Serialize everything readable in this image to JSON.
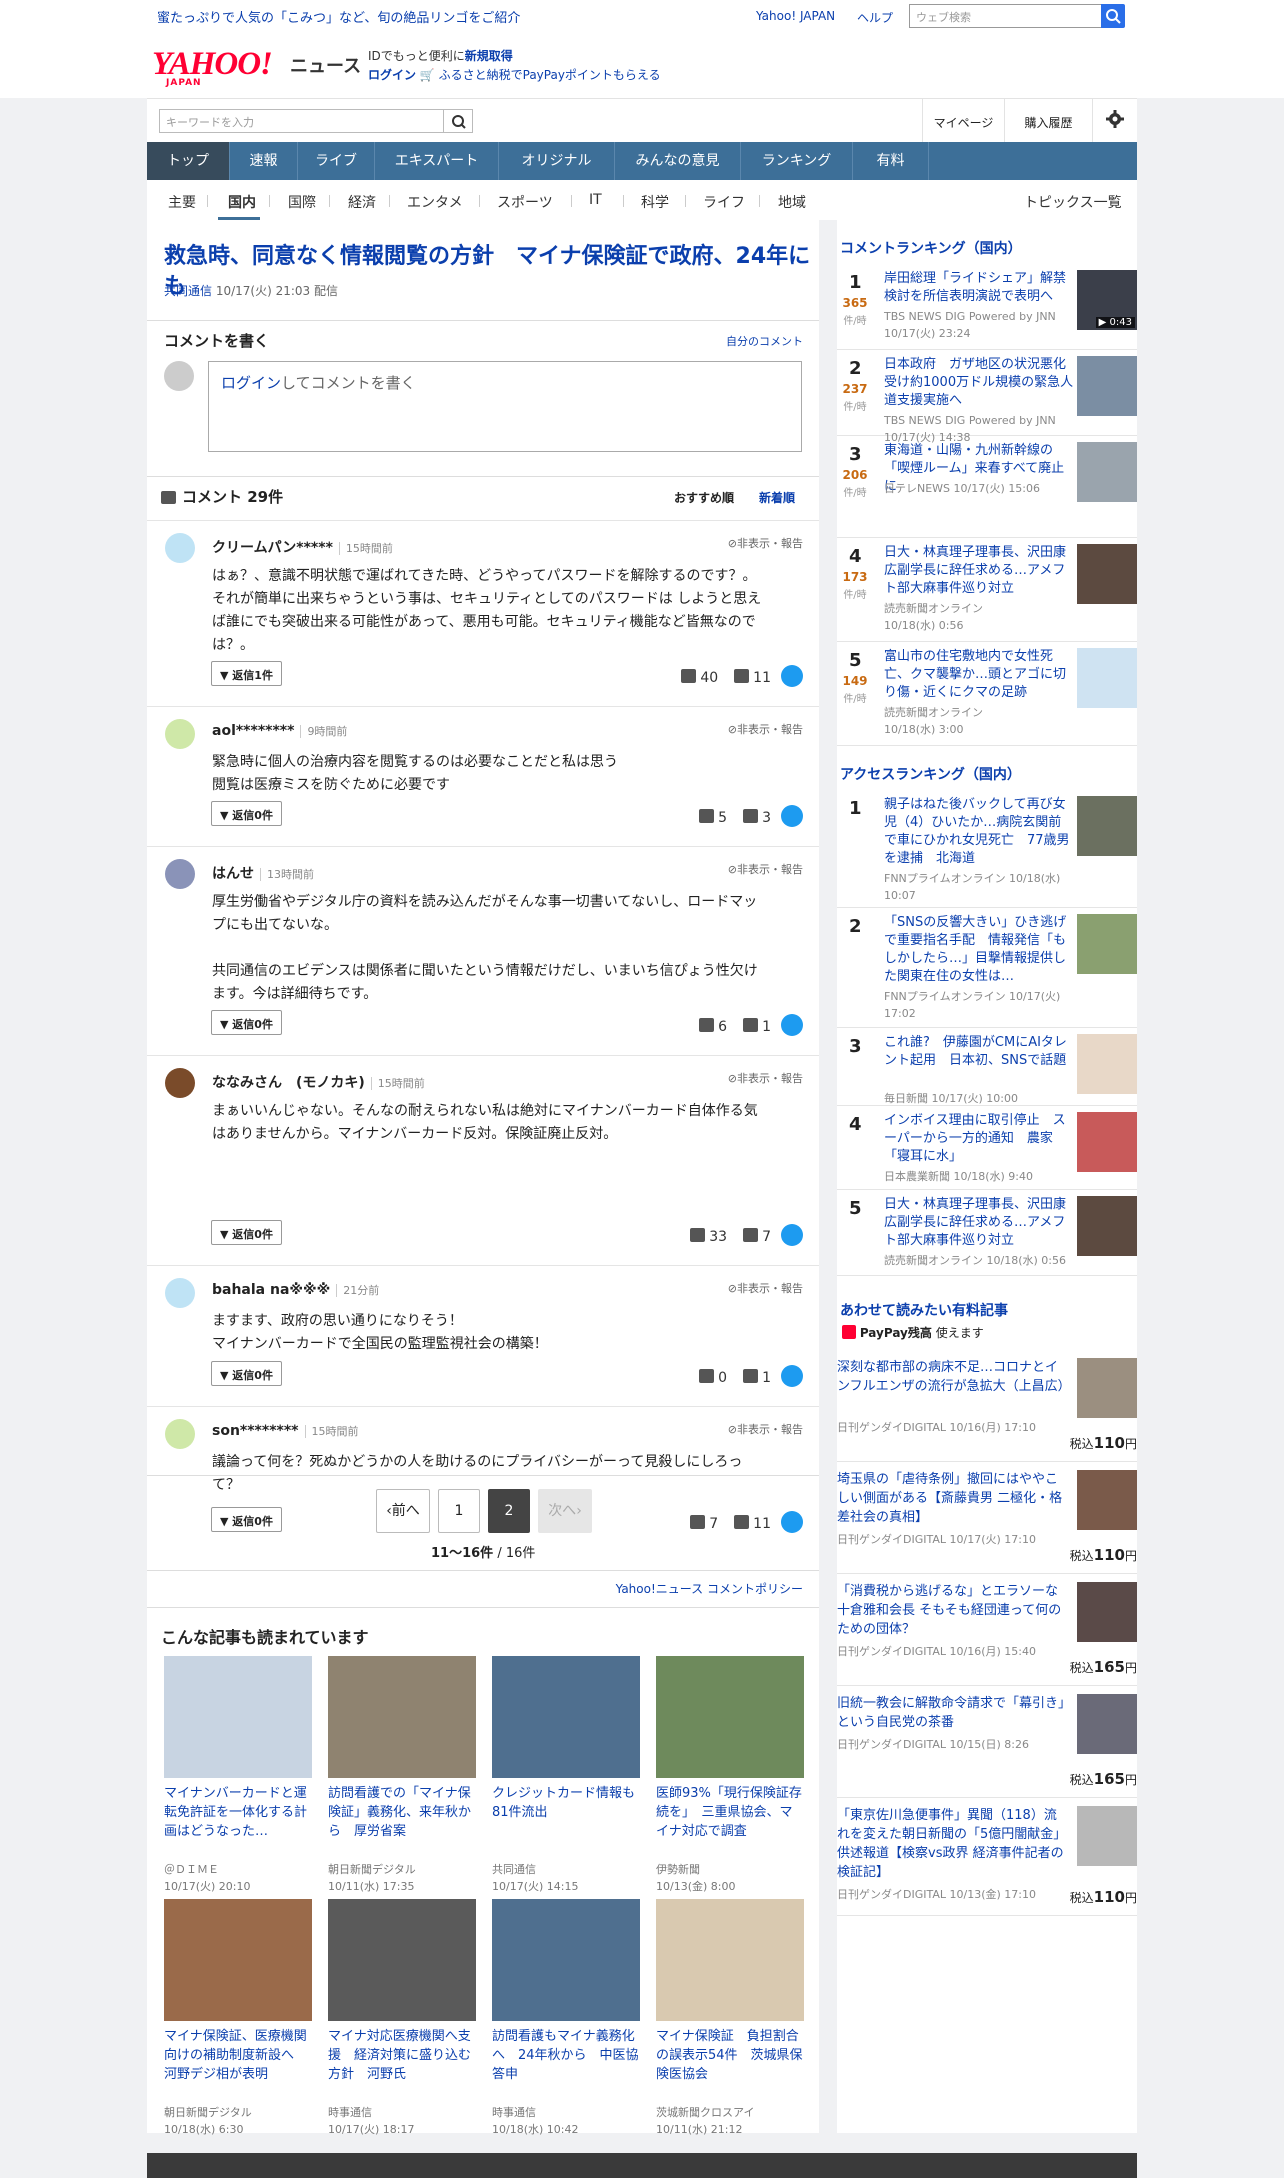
{
  "topbar": {
    "promo": "蜜たっぷりで人気の「こみつ」など、旬の絶品リンゴをご紹介",
    "yahoo_japan": "Yahoo! JAPAN",
    "help": "ヘルプ",
    "search_placeholder": "ウェブ検索"
  },
  "header": {
    "logo": "YAHOO!",
    "logo_sub": "JAPAN",
    "logo_news": "ニュース",
    "line1_prefix": "IDでもっと便利に",
    "line1_link": "新規取得",
    "login": "ログイン",
    "line2": "ふるさと納税でPayPayポイントもらえる"
  },
  "searchrow": {
    "placeholder": "キーワードを入力",
    "mypage": "マイページ",
    "history": "購入履歴"
  },
  "nav1": [
    "トップ",
    "速報",
    "ライブ",
    "エキスパート",
    "オリジナル",
    "みんなの意見",
    "ランキング",
    "有料"
  ],
  "nav2": [
    "主要",
    "国内",
    "国際",
    "経済",
    "エンタメ",
    "スポーツ",
    "IT",
    "科学",
    "ライフ",
    "地域"
  ],
  "nav2_all": "トピックス一覧",
  "article": {
    "title": "救急時、同意なく情報閲覧の方針　マイナ保険証で政府、24年にも",
    "source": "共同通信",
    "date": "10/17(火) 21:03 配信"
  },
  "comment_write": {
    "title": "コメントを書く",
    "own": "自分のコメント",
    "login": "ログイン",
    "placeholder": "してコメントを書く"
  },
  "comments_head": {
    "title": "コメント 29件",
    "sort_recommended": "おすすめ順",
    "sort_new": "新着順"
  },
  "comment_hide": "非表示・報告",
  "comments": [
    {
      "user": "クリームパン*****",
      "time": "15時間前",
      "body": "はぁ？、意識不明状態で運ばれてきた時、どうやってパスワードを解除するのです？。\nそれが簡単に出来ちゃうという事は、セキュリティとしてのパスワードは しようと思え\nば誰にでも突破出来る可能性があって、悪用も可能。セキュリティ機能など皆無なので\nは？。",
      "reply": "返信1件",
      "good": "40",
      "bad": "11",
      "color": "#bfe3f5"
    },
    {
      "user": "aol********",
      "time": "9時間前",
      "body": "緊急時に個人の治療内容を閲覧するのは必要なことだと私は思う\n閲覧は医療ミスを防ぐために必要です",
      "reply": "返信0件",
      "good": "5",
      "bad": "3",
      "color": "#cfe8a8"
    },
    {
      "user": "はんせ",
      "time": "13時間前",
      "body": "厚生労働省やデジタル庁の資料を読み込んだがそんな事一切書いてないし、ロードマッ\nプにも出てないな。\n\n共同通信のエビデンスは関係者に聞いたという情報だけだし、いまいち信ぴょう性欠け\nます。今は詳細待ちです。",
      "reply": "返信0件",
      "good": "6",
      "bad": "1",
      "color": "#8a93b8"
    },
    {
      "user": "ななみさん　(モノカキ)",
      "time": "15時間前",
      "body": "まぁいいんじゃない。そんなの耐えられない私は絶対にマイナンバーカード自体作る気\nはありませんから。マイナンバーカード反対。保険証廃止反対。",
      "reply": "返信0件",
      "good": "33",
      "bad": "7",
      "color": "#7a4b2a"
    },
    {
      "user": "bahala na※※※",
      "time": "21分前",
      "body": "ますます、政府の思い通りになりそう！\nマイナンバーカードで全国民の監理監視社会の構築！",
      "reply": "返信0件",
      "good": "0",
      "bad": "1",
      "color": "#bfe3f5"
    },
    {
      "user": "son********",
      "time": "15時間前",
      "body": "議論って何を？死ぬかどうかの人を助けるのにプライバシーがーって見殺しにしろっ\nて？",
      "reply": "返信0件",
      "good": "7",
      "bad": "11",
      "color": "#cfe8a8"
    }
  ],
  "pager": {
    "prev": "前へ",
    "p1": "1",
    "p2": "2",
    "next": "次へ",
    "count_bold": "11〜16件",
    "count_total": " / 16件"
  },
  "policy": "Yahoo!ニュース コメントポリシー",
  "related_title": "こんな記事も読まれています",
  "related": [
    {
      "title": "マイナンバーカードと運転免許証を一体化する計画はどうなった…",
      "source": "＠ＤＩＭＥ",
      "date": "10/17(火) 20:10",
      "bg": "#c8d4e2"
    },
    {
      "title": "訪問看護での「マイナ保険証」義務化、来年秋から　厚労省案",
      "source": "朝日新聞デジタル",
      "date": "10/11(水) 17:35",
      "bg": "#8f8370"
    },
    {
      "title": "クレジットカード情報も81件流出",
      "source": "共同通信",
      "date": "10/17(火) 14:15",
      "bg": "#4f6f8f"
    },
    {
      "title": "医師93%「現行保険証存続を」　三重県協会、マイナ対応で調査",
      "source": "伊勢新聞",
      "date": "10/13(金) 8:00",
      "bg": "#6e8a5c"
    },
    {
      "title": "マイナ保険証、医療機関向けの補助制度新設へ　河野デジ相が表明",
      "source": "朝日新聞デジタル",
      "date": "10/18(水) 6:30",
      "bg": "#9a6a4a"
    },
    {
      "title": "マイナ対応医療機関へ支援　経済対策に盛り込む方針　河野氏",
      "source": "時事通信",
      "date": "10/17(火) 18:17",
      "bg": "#5a5a5a"
    },
    {
      "title": "訪問看護もマイナ義務化へ　24年秋から　中医協答申",
      "source": "時事通信",
      "date": "10/18(水) 10:42",
      "bg": "#4f6f8f"
    },
    {
      "title": "マイナ保険証　負担割合の誤表示54件　茨城県保険医協会",
      "source": "茨城新聞クロスアイ",
      "date": "10/11(水) 21:12",
      "bg": "#d9c9b0"
    }
  ],
  "comment_ranking_title": "コメントランキング（国内）",
  "count_unit": "件/時",
  "comment_ranking": [
    {
      "rank": "1",
      "count": "365",
      "title": "岸田総理「ライドシェア」解禁検討を所信表明演説で表明へ",
      "source": "TBS NEWS DIG Powered by JNN",
      "date": "10/17(火) 23:24",
      "video": "▶ 0:43",
      "bg": "#3b3f4a"
    },
    {
      "rank": "2",
      "count": "237",
      "title": "日本政府　ガザ地区の状況悪化受け約1000万ドル規模の緊急人道支援実施へ",
      "source": "TBS NEWS DIG Powered by JNN",
      "date": "10/17(火) 14:38",
      "bg": "#7b8ea3"
    },
    {
      "rank": "3",
      "count": "206",
      "title": "東海道・山陽・九州新幹線の「喫煙ルーム」来春すべて廃止に",
      "source": "日テレNEWS 10/17(火) 15:06",
      "date": "",
      "bg": "#9aa4ad"
    },
    {
      "rank": "4",
      "count": "173",
      "title": "日大・林真理子理事長、沢田康広副学長に辞任求める…アメフト部大麻事件巡り対立",
      "source": "読売新聞オンライン",
      "date": "10/18(水) 0:56",
      "bg": "#5c4a40"
    },
    {
      "rank": "5",
      "count": "149",
      "title": "富山市の住宅敷地内で女性死亡、クマ襲撃か…頭とアゴに切り傷・近くにクマの足跡",
      "source": "読売新聞オンライン",
      "date": "10/18(水) 3:00",
      "bg": "#cfe3f2"
    }
  ],
  "access_ranking_title": "アクセスランキング（国内）",
  "access_ranking": [
    {
      "rank": "1",
      "title": "親子はねた後バックして再び女児（4）ひいたか…病院玄関前で車にひかれ女児死亡　77歳男を逮捕　北海道",
      "source": "FNNプライムオンライン 10/18(水)",
      "date": "10:07",
      "bg": "#6b7060"
    },
    {
      "rank": "2",
      "title": "「SNSの反響大きい」ひき逃げで重要指名手配　情報発信「もしかしたら…」目撃情報提供した関東在住の女性は…",
      "source": "FNNプライムオンライン 10/17(火)",
      "date": "17:02",
      "bg": "#8aa070"
    },
    {
      "rank": "3",
      "title": "これ誰?　伊藤園がCMにAIタレント起用　日本初、SNSで話題",
      "source": "毎日新聞 10/17(火) 10:00",
      "date": "",
      "bg": "#e8d8c8"
    },
    {
      "rank": "4",
      "title": "インボイス理由に取引停止　スーパーから一方的通知　農家「寝耳に水」",
      "source": "日本農業新聞 10/18(水) 9:40",
      "date": "",
      "bg": "#c85a5a"
    },
    {
      "rank": "5",
      "title": "日大・林真理子理事長、沢田康広副学長に辞任求める…アメフト部大麻事件巡り対立",
      "source": "読売新聞オンライン 10/18(水) 0:56",
      "date": "",
      "bg": "#5c4a40"
    }
  ],
  "paid_title": "あわせて読みたい有料記事",
  "paypay": "PayPay残高",
  "paypay_suffix": "使えます",
  "tax_label": "税込",
  "yen": "円",
  "paid": [
    {
      "title": "深刻な都市部の病床不足…コロナとインフルエンザの流行が急拡大（上昌広）",
      "source": "日刊ゲンダイDIGITAL 10/16(月) 17:10",
      "price": "110",
      "bg": "#9b8f80"
    },
    {
      "title": "埼玉県の「虐待条例」撤回にはややこしい側面がある【斎藤貴男 二極化・格差社会の真相】",
      "source": "日刊ゲンダイDIGITAL 10/17(火) 17:10",
      "price": "110",
      "bg": "#7a5a4a"
    },
    {
      "title": "「消費税から逃げるな」とエラソーな十倉雅和会長 そもそも経団連って何のための団体？",
      "source": "日刊ゲンダイDIGITAL 10/16(月) 15:40",
      "price": "165",
      "bg": "#5a4a48"
    },
    {
      "title": "旧統一教会に解散命令請求で「幕引き」という自民党の茶番",
      "source": "日刊ゲンダイDIGITAL 10/15(日) 8:26",
      "price": "165",
      "bg": "#6a6a78"
    },
    {
      "title": "「東京佐川急便事件」異聞（118）流れを変えた朝日新聞の「5億円闇献金」供述報道【検察vs政界 経済事件記者の検証記】",
      "source": "日刊ゲンダイDIGITAL 10/13(金) 17:10",
      "price": "110",
      "bg": "#b8b8b8"
    }
  ]
}
